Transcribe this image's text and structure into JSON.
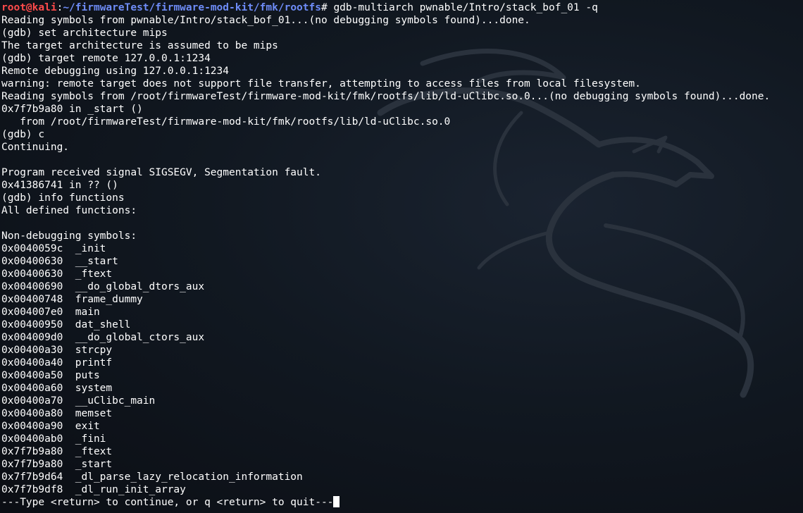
{
  "terminal": {
    "prompt": {
      "user_host": "root@kali",
      "separator": ":",
      "path": "~/firmwareTest/firmware-mod-kit/fmk/rootfs",
      "symbol": "# ",
      "command": "gdb-multiarch pwnable/Intro/stack_bof_01 -q"
    },
    "lines": [
      "Reading symbols from pwnable/Intro/stack_bof_01...(no debugging symbols found)...done.",
      "(gdb) set architecture mips",
      "The target architecture is assumed to be mips",
      "(gdb) target remote 127.0.0.1:1234",
      "Remote debugging using 127.0.0.1:1234",
      "warning: remote target does not support file transfer, attempting to access files from local filesystem.",
      "Reading symbols from /root/firmwareTest/firmware-mod-kit/fmk/rootfs/lib/ld-uClibc.so.0...(no debugging symbols found)...done.",
      "0x7f7b9a80 in _start ()",
      "   from /root/firmwareTest/firmware-mod-kit/fmk/rootfs/lib/ld-uClibc.so.0",
      "(gdb) c",
      "Continuing.",
      "",
      "Program received signal SIGSEGV, Segmentation fault.",
      "0x41386741 in ?? ()",
      "(gdb) info functions",
      "All defined functions:",
      "",
      "Non-debugging symbols:",
      "0x0040059c  _init",
      "0x00400630  __start",
      "0x00400630  _ftext",
      "0x00400690  __do_global_dtors_aux",
      "0x00400748  frame_dummy",
      "0x004007e0  main",
      "0x00400950  dat_shell",
      "0x004009d0  __do_global_ctors_aux",
      "0x00400a30  strcpy",
      "0x00400a40  printf",
      "0x00400a50  puts",
      "0x00400a60  system",
      "0x00400a70  __uClibc_main",
      "0x00400a80  memset",
      "0x00400a90  exit",
      "0x00400ab0  _fini",
      "0x7f7b9a80  _ftext",
      "0x7f7b9a80  _start",
      "0x7f7b9d64  _dl_parse_lazy_relocation_information",
      "0x7f7b9df8  _dl_run_init_array"
    ],
    "pager_prompt": "---Type <return> to continue, or q <return> to quit---"
  },
  "colors": {
    "background": "#0b0e14",
    "text": "#ffffff",
    "prompt_user": "#ff4b4b",
    "prompt_path": "#6e8cf7"
  }
}
